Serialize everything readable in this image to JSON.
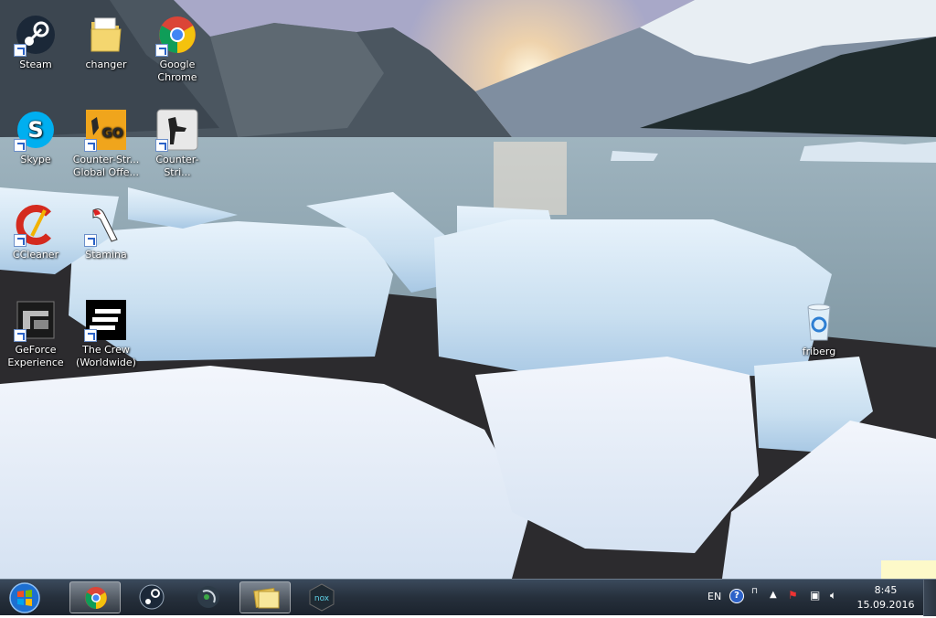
{
  "desktop_icons": [
    {
      "id": "steam",
      "label": "Steam",
      "icon": "steam-icon"
    },
    {
      "id": "changer",
      "label": "changer",
      "icon": "folder-icon"
    },
    {
      "id": "chrome",
      "label": "Google Chrome",
      "icon": "chrome-icon"
    },
    {
      "id": "skype",
      "label": "Skype",
      "icon": "skype-icon"
    },
    {
      "id": "csgo",
      "label": "Counter-Str... Global Offe...",
      "icon": "csgo-icon"
    },
    {
      "id": "cs",
      "label": "Counter-Stri...",
      "icon": "counter-strike-icon"
    },
    {
      "id": "ccleaner",
      "label": "CCleaner",
      "icon": "ccleaner-icon"
    },
    {
      "id": "stamina",
      "label": "Stamina",
      "icon": "stamina-icon"
    },
    {
      "id": "geforce",
      "label": "GeForce Experience",
      "icon": "geforce-icon"
    },
    {
      "id": "thecrew",
      "label": "The Crew (Worldwide)",
      "icon": "the-crew-icon"
    },
    {
      "id": "recycle",
      "label": "friberg",
      "icon": "recycle-bin-icon"
    }
  ],
  "taskbar": {
    "pinned": [
      "chrome-icon",
      "steam-icon",
      "steam-overlay-icon",
      "windows-explorer-icon",
      "nox-icon"
    ],
    "tray": {
      "language": "EN",
      "help": "?"
    },
    "clock": {
      "time": "8:45",
      "date": "15.09.2016"
    }
  }
}
